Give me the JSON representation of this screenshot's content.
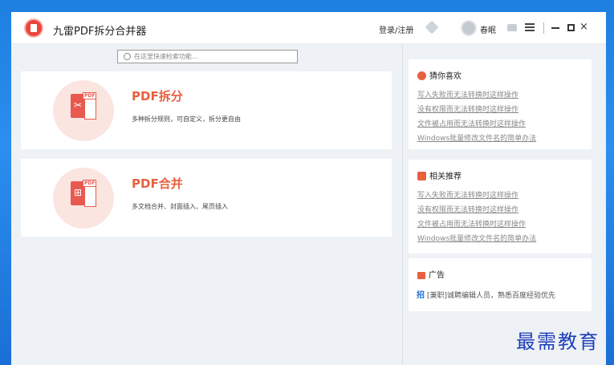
{
  "titlebar": {
    "app_title": "九雷PDF拆分合并器",
    "login_label": "登录/注册",
    "username": "春眠",
    "close_glyph": "×"
  },
  "search": {
    "placeholder": "在这里快速检索功能..."
  },
  "features": [
    {
      "title": "PDF拆分",
      "desc": "多种拆分规则，可自定义，拆分更自由",
      "tag": "PDF",
      "icon": "scissors-icon",
      "glyph": "✂"
    },
    {
      "title": "PDF合并",
      "desc": "多文档合并、封面插入、尾页插入",
      "tag": "PDF",
      "icon": "merge-icon",
      "glyph": "⊞"
    }
  ],
  "panels": {
    "guess": {
      "title": "猜你喜欢",
      "links": [
        "写入失败而无法转换时这样操作",
        "没有权限而无法转换时这样操作",
        "文件被占用而无法转换时这样操作",
        "Windows批量修改文件名的简单办法"
      ]
    },
    "recommend": {
      "title": "相关推荐",
      "links": [
        "写入失败而无法转换时这样操作",
        "没有权限而无法转换时这样操作",
        "文件被占用而无法转换时这样操作",
        "Windows批量修改文件名的简单办法"
      ]
    },
    "ad": {
      "title": "广告",
      "badge": "招",
      "text": "[兼职]诚聘编辑人员，熟悉百度经验优先"
    }
  },
  "watermark": "最需教育",
  "colors": {
    "accent": "#e8603f",
    "link": "#888888",
    "brand_blue": "#1a6fd6"
  }
}
